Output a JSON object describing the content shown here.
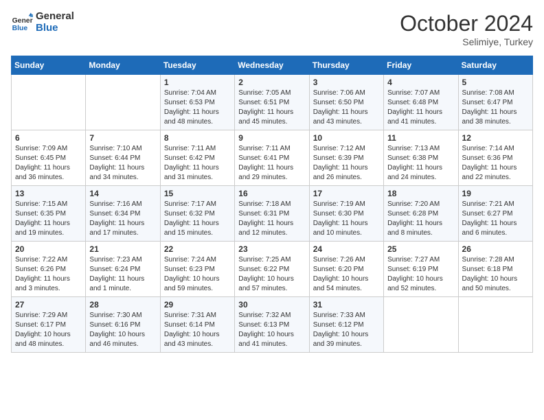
{
  "header": {
    "logo_line1": "General",
    "logo_line2": "Blue",
    "month": "October 2024",
    "location": "Selimiye, Turkey"
  },
  "days_of_week": [
    "Sunday",
    "Monday",
    "Tuesday",
    "Wednesday",
    "Thursday",
    "Friday",
    "Saturday"
  ],
  "weeks": [
    [
      {
        "day": "",
        "content": ""
      },
      {
        "day": "",
        "content": ""
      },
      {
        "day": "1",
        "content": "Sunrise: 7:04 AM\nSunset: 6:53 PM\nDaylight: 11 hours and 48 minutes."
      },
      {
        "day": "2",
        "content": "Sunrise: 7:05 AM\nSunset: 6:51 PM\nDaylight: 11 hours and 45 minutes."
      },
      {
        "day": "3",
        "content": "Sunrise: 7:06 AM\nSunset: 6:50 PM\nDaylight: 11 hours and 43 minutes."
      },
      {
        "day": "4",
        "content": "Sunrise: 7:07 AM\nSunset: 6:48 PM\nDaylight: 11 hours and 41 minutes."
      },
      {
        "day": "5",
        "content": "Sunrise: 7:08 AM\nSunset: 6:47 PM\nDaylight: 11 hours and 38 minutes."
      }
    ],
    [
      {
        "day": "6",
        "content": "Sunrise: 7:09 AM\nSunset: 6:45 PM\nDaylight: 11 hours and 36 minutes."
      },
      {
        "day": "7",
        "content": "Sunrise: 7:10 AM\nSunset: 6:44 PM\nDaylight: 11 hours and 34 minutes."
      },
      {
        "day": "8",
        "content": "Sunrise: 7:11 AM\nSunset: 6:42 PM\nDaylight: 11 hours and 31 minutes."
      },
      {
        "day": "9",
        "content": "Sunrise: 7:11 AM\nSunset: 6:41 PM\nDaylight: 11 hours and 29 minutes."
      },
      {
        "day": "10",
        "content": "Sunrise: 7:12 AM\nSunset: 6:39 PM\nDaylight: 11 hours and 26 minutes."
      },
      {
        "day": "11",
        "content": "Sunrise: 7:13 AM\nSunset: 6:38 PM\nDaylight: 11 hours and 24 minutes."
      },
      {
        "day": "12",
        "content": "Sunrise: 7:14 AM\nSunset: 6:36 PM\nDaylight: 11 hours and 22 minutes."
      }
    ],
    [
      {
        "day": "13",
        "content": "Sunrise: 7:15 AM\nSunset: 6:35 PM\nDaylight: 11 hours and 19 minutes."
      },
      {
        "day": "14",
        "content": "Sunrise: 7:16 AM\nSunset: 6:34 PM\nDaylight: 11 hours and 17 minutes."
      },
      {
        "day": "15",
        "content": "Sunrise: 7:17 AM\nSunset: 6:32 PM\nDaylight: 11 hours and 15 minutes."
      },
      {
        "day": "16",
        "content": "Sunrise: 7:18 AM\nSunset: 6:31 PM\nDaylight: 11 hours and 12 minutes."
      },
      {
        "day": "17",
        "content": "Sunrise: 7:19 AM\nSunset: 6:30 PM\nDaylight: 11 hours and 10 minutes."
      },
      {
        "day": "18",
        "content": "Sunrise: 7:20 AM\nSunset: 6:28 PM\nDaylight: 11 hours and 8 minutes."
      },
      {
        "day": "19",
        "content": "Sunrise: 7:21 AM\nSunset: 6:27 PM\nDaylight: 11 hours and 6 minutes."
      }
    ],
    [
      {
        "day": "20",
        "content": "Sunrise: 7:22 AM\nSunset: 6:26 PM\nDaylight: 11 hours and 3 minutes."
      },
      {
        "day": "21",
        "content": "Sunrise: 7:23 AM\nSunset: 6:24 PM\nDaylight: 11 hours and 1 minute."
      },
      {
        "day": "22",
        "content": "Sunrise: 7:24 AM\nSunset: 6:23 PM\nDaylight: 10 hours and 59 minutes."
      },
      {
        "day": "23",
        "content": "Sunrise: 7:25 AM\nSunset: 6:22 PM\nDaylight: 10 hours and 57 minutes."
      },
      {
        "day": "24",
        "content": "Sunrise: 7:26 AM\nSunset: 6:20 PM\nDaylight: 10 hours and 54 minutes."
      },
      {
        "day": "25",
        "content": "Sunrise: 7:27 AM\nSunset: 6:19 PM\nDaylight: 10 hours and 52 minutes."
      },
      {
        "day": "26",
        "content": "Sunrise: 7:28 AM\nSunset: 6:18 PM\nDaylight: 10 hours and 50 minutes."
      }
    ],
    [
      {
        "day": "27",
        "content": "Sunrise: 7:29 AM\nSunset: 6:17 PM\nDaylight: 10 hours and 48 minutes."
      },
      {
        "day": "28",
        "content": "Sunrise: 7:30 AM\nSunset: 6:16 PM\nDaylight: 10 hours and 46 minutes."
      },
      {
        "day": "29",
        "content": "Sunrise: 7:31 AM\nSunset: 6:14 PM\nDaylight: 10 hours and 43 minutes."
      },
      {
        "day": "30",
        "content": "Sunrise: 7:32 AM\nSunset: 6:13 PM\nDaylight: 10 hours and 41 minutes."
      },
      {
        "day": "31",
        "content": "Sunrise: 7:33 AM\nSunset: 6:12 PM\nDaylight: 10 hours and 39 minutes."
      },
      {
        "day": "",
        "content": ""
      },
      {
        "day": "",
        "content": ""
      }
    ]
  ]
}
